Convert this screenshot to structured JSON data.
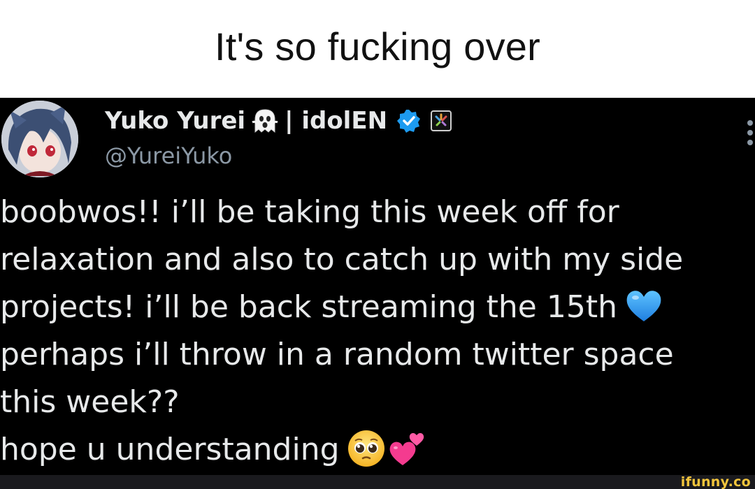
{
  "caption": {
    "text": "It's so fucking over"
  },
  "tweet": {
    "display_name": "Yuko Yurei",
    "name_separator": "| idolEN",
    "handle": "@YureiYuko",
    "body_lines": [
      "boobwos!! i’ll be taking this week off for",
      "relaxation and also to catch up with my side",
      "projects! i’ll be back streaming  the 15th",
      "perhaps i’ll throw in a random twitter space",
      "this week??",
      "hope u understanding"
    ],
    "emojis": {
      "name": "ghost-emoji",
      "line3": "blue-heart-emoji",
      "line6": [
        "pleading-face-emoji",
        "two-hearts-emoji"
      ]
    },
    "badge_color": "#1d9bf0"
  },
  "footer": {
    "watermark": "ifunny.co"
  },
  "colors": {
    "caption_bg": "#ffffff",
    "tweet_bg": "#000000",
    "text_primary": "#e7e9ea",
    "text_secondary": "#8b98a5",
    "watermark": "#f2c53d"
  }
}
